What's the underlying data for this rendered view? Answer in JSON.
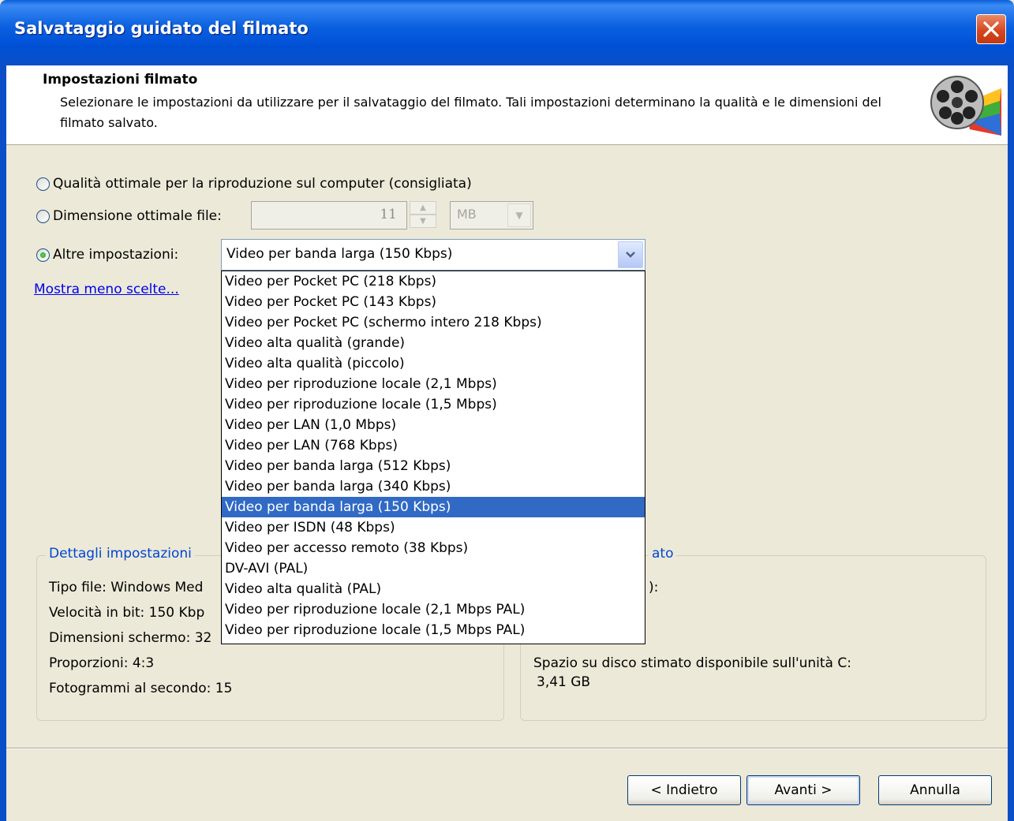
{
  "window": {
    "title": "Salvataggio guidato del filmato"
  },
  "header": {
    "title": "Impostazioni filmato",
    "description": "Selezionare le impostazioni da utilizzare per il salvataggio del filmato. Tali impostazioni determinano la qualità e le dimensioni del filmato salvato."
  },
  "options": {
    "best_quality_label": "Qualità ottimale per la riproduzione sul computer (consigliata)",
    "best_size_label": "Dimensione ottimale file:",
    "best_size_value": "11",
    "best_size_unit": "MB",
    "other_label": "Altre impostazioni:",
    "other_value": "Video per banda larga (150 Kbps)",
    "selected_option": "other",
    "show_fewer_link": "Mostra meno scelte..."
  },
  "dropdown": {
    "items": [
      "Video per Pocket PC (218 Kbps)",
      "Video per Pocket PC (143 Kbps)",
      "Video per Pocket PC (schermo intero 218 Kbps)",
      "Video alta qualità (grande)",
      "Video alta qualità (piccolo)",
      "Video per riproduzione locale (2,1 Mbps)",
      "Video per riproduzione locale (1,5 Mbps)",
      "Video per LAN (1,0 Mbps)",
      "Video per LAN (768 Kbps)",
      "Video per banda larga (512 Kbps)",
      "Video per banda larga (340 Kbps)",
      "Video per banda larga (150 Kbps)",
      "Video per ISDN (48 Kbps)",
      "Video per accesso remoto (38 Kbps)",
      "DV-AVI (PAL)",
      "Video alta qualità (PAL)",
      "Video per riproduzione locale (2,1 Mbps PAL)",
      "Video per riproduzione locale (1,5 Mbps PAL)"
    ],
    "selected_index": 11
  },
  "details": {
    "legend": "Dettagli impostazioni",
    "file_type": "Tipo file: Windows Med",
    "bitrate": "Velocità in bit: 150 Kbp",
    "screen_size": "Dimensioni schermo: 32",
    "aspect_ratio": "Proporzioni: 4:3",
    "fps": "Fotogrammi al secondo: 15"
  },
  "file_info": {
    "legend_fragment": "ato",
    "line1_fragment": "):",
    "disk_space_label": "Spazio su disco stimato disponibile sull'unità C:",
    "disk_space_value": "3,41 GB"
  },
  "buttons": {
    "back": "< Indietro",
    "next": "Avanti >",
    "cancel": "Annulla"
  },
  "colors": {
    "titlebar": "#0A5FD8",
    "selection": "#316AC5",
    "link": "#0000EE",
    "group_legend": "#0046D5",
    "dialog_bg": "#ECE9D8"
  }
}
